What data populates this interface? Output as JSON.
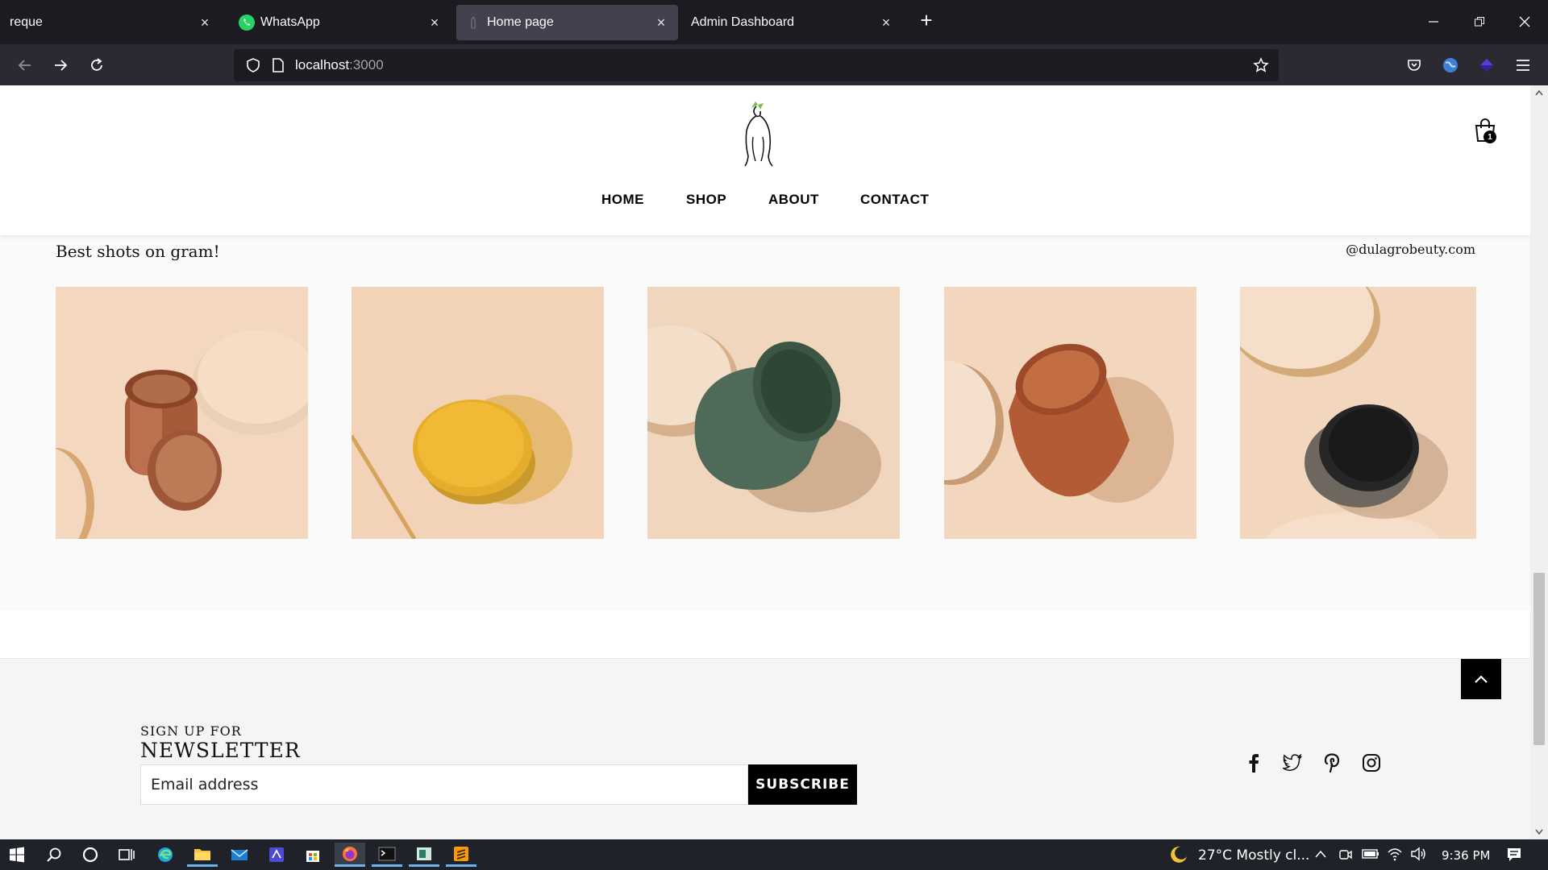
{
  "browser": {
    "tabs": [
      {
        "title": "reque",
        "active": false
      },
      {
        "title": "WhatsApp",
        "active": false,
        "icon": "whatsapp-icon"
      },
      {
        "title": "Home page",
        "active": true,
        "icon": "site-favicon"
      },
      {
        "title": "Admin Dashboard",
        "active": false
      }
    ],
    "url_host": "localhost",
    "url_port": ":3000"
  },
  "site": {
    "cart_count": "1",
    "nav": [
      "HOME",
      "SHOP",
      "ABOUT",
      "CONTACT"
    ]
  },
  "gram": {
    "title": "Best shots on gram!",
    "handle": "@dulagrobeuty.com",
    "shots": [
      {
        "name": "copper-tin",
        "color": "#b4704c"
      },
      {
        "name": "yellow-tin",
        "color": "#e9b23a"
      },
      {
        "name": "green-jar",
        "color": "#57735e"
      },
      {
        "name": "terracotta-jar",
        "color": "#b9643f"
      },
      {
        "name": "black-tin",
        "color": "#2b2b2b"
      }
    ]
  },
  "newsletter": {
    "small": "SIGN UP FOR",
    "big": "NEWSLETTER",
    "placeholder": "Email address",
    "button": "SUBSCRIBE"
  },
  "taskbar": {
    "weather": "27°C  Mostly cl...",
    "time": "9:36 PM"
  }
}
